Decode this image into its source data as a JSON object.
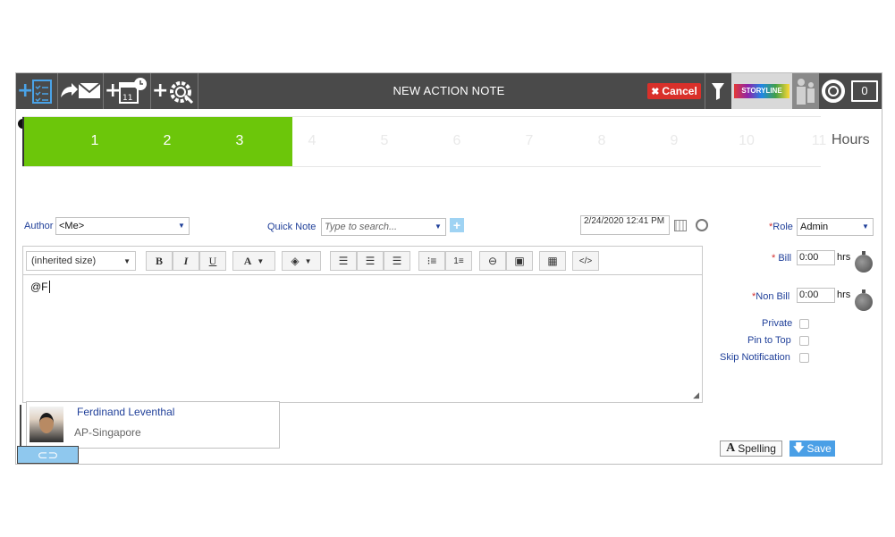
{
  "toolbar": {
    "title": "NEW ACTION NOTE",
    "cancel_label": "Cancel",
    "storyline_label": "STORYLINE",
    "screen_badge": "0",
    "icons": [
      "add-task-icon",
      "forward-email-icon",
      "add-calendar-icon",
      "add-settings-icon",
      "filter-icon",
      "contacts-icon",
      "help-lifebuoy-icon",
      "screen-icon"
    ]
  },
  "hours": {
    "numbers": [
      "1",
      "2",
      "3",
      "4",
      "5",
      "6",
      "7",
      "8",
      "9",
      "10",
      "11"
    ],
    "selected_count": 3,
    "label": "Hours",
    "fill_color": "#6cc60a"
  },
  "form": {
    "author_label": "Author",
    "author_value": "<Me>",
    "quick_note_label": "Quick Note",
    "quick_note_placeholder": "Type to search...",
    "date_value": "2/24/2020 12:41 PM",
    "role_label": "Role",
    "role_value": "Admin"
  },
  "editor": {
    "font_size_value": "(inherited size)",
    "buttons": [
      "B",
      "I",
      "U",
      "A"
    ],
    "content": "@F"
  },
  "mention": {
    "name": "Ferdinand Leventhal",
    "office": "AP-Singapore"
  },
  "right": {
    "bill_label": "Bill",
    "bill_value": "0:00",
    "non_bill_label": "Non Bill",
    "non_bill_value": "0:00",
    "hrs_label": "hrs",
    "private_label": "Private",
    "pin_label": "Pin to Top",
    "skip_label": "Skip Notification"
  },
  "actions": {
    "spelling_label": "Spelling",
    "save_label": "Save"
  },
  "colors": {
    "toolbar_bg": "#4a4a4a",
    "cancel": "#d9302a",
    "save": "#4a9fe6",
    "link": "#1f3f99"
  }
}
